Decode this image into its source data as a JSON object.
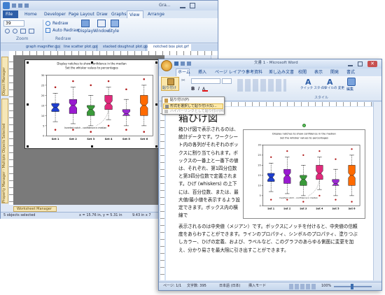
{
  "app": {
    "title": "Gra...",
    "tabs": [
      "File",
      "Home",
      "Developer",
      "Page Layout",
      "Draw",
      "Graphs",
      "View",
      "Arrange"
    ],
    "active_tab": "View",
    "zoom_value": "39",
    "redraw_label": "Redraw",
    "auto_redraw_label": "Auto Redraw",
    "window_label": "Window",
    "display_label": "Display",
    "style_label": "Style",
    "group_zoom": "Zoom",
    "group_redraw": "Redraw",
    "doc_tabs": [
      "graph magnifier.gpj",
      "line scatter plot.gpj",
      "stacked doughnut plot.gpj",
      "notched box plot.grf"
    ],
    "side_panels": [
      "Object Manager",
      "Property Manager - Multiple Objects Selected"
    ],
    "worksheet_manager": "Worksheet Manager",
    "status_left": "5 objects selected",
    "status_coords": "x = 15.76 in, y = 5.31 in",
    "status_size": "9.43 in x 7"
  },
  "word": {
    "title": "文書 1 - Microsoft Word",
    "tabs": [
      "ホーム",
      "挿入",
      "ページ レイアウト",
      "参考資料",
      "差し込み文書",
      "校閲",
      "表示",
      "開発",
      "書式"
    ],
    "active_tab": "ホーム",
    "paste_label": "貼り付け",
    "menu_items": [
      "貼り付け(P)",
      "形式を選択して貼り付け(S)...",
      "ハイパーリンクとして貼り付け(H)"
    ],
    "quick_style": "クイック スタイル",
    "style_change": "スタイルの 変更",
    "edit_label": "編集",
    "style_group": "スタイル",
    "heading": "箱ひげ図",
    "body_narrow": "箱ひげ図で表示されるのは、統計データです。ワークシート内の各列がそれぞれのボックスに割り当てられます。ボックスの一番上と一番下の値は、それぞれ、第1四分位数と第3四分位数で定義されます。ひげ (whiskers) の上下には、百分位数、または、最大値/最小値を表示するよう設定できます。ボックス内の横線で",
    "body_wide": "表示されるのは中央値（メジアン）です。ボックスにノッチを付けると、中央値の信頼度をあらわすことができます。ラインのプロパティ、シンボルのプロパティ、塗りつぶしカラー、ひげの定義、および、ラベルなど、このグラフのあらゆる側面に変更を加え、分かり易さを最大限に引き出すことができます。",
    "status_page": "ページ: 1/1",
    "status_words": "文字数: 395",
    "status_lang": "日本語 (日本)",
    "status_mode": "挿入モード",
    "zoom_pct": "100%"
  },
  "chart_data": {
    "type": "box",
    "title": "Display notches to show confidence in the median",
    "subtitle": "Set the whisker values to percentages",
    "categories": [
      "Set 1",
      "Set 2",
      "Set 3",
      "Set 4",
      "Set 5",
      "Set 6"
    ],
    "annotation": "Inverted notch - confidence in median",
    "ylim": [
      0,
      30
    ],
    "yticks": [
      0,
      5,
      10,
      15,
      20,
      25,
      30
    ],
    "colors": [
      "#1f3fd0",
      "#9a1ad0",
      "#3a9a3a",
      "#e02a7c",
      "#9a2ad0",
      "#ff6a00"
    ],
    "boxes": [
      {
        "q1": 12,
        "median": 14,
        "q3": 16,
        "lo": 7,
        "hi": 21,
        "outliers": [
          24,
          3
        ]
      },
      {
        "q1": 11,
        "median": 15,
        "q3": 18,
        "lo": 6,
        "hi": 24,
        "outliers": [
          27,
          3
        ]
      },
      {
        "q1": 10,
        "median": 13,
        "q3": 15,
        "lo": 5,
        "hi": 20,
        "outliers": [
          25,
          2
        ]
      },
      {
        "q1": 13,
        "median": 16,
        "q3": 20,
        "lo": 8,
        "hi": 24,
        "outliers": [
          27,
          5
        ]
      },
      {
        "q1": 10,
        "median": 11,
        "q3": 13,
        "lo": 5,
        "hi": 18,
        "outliers": [
          23,
          3
        ]
      },
      {
        "q1": 10,
        "median": 15,
        "q3": 20,
        "lo": 5,
        "hi": 25,
        "outliers": [
          28,
          2
        ]
      }
    ]
  }
}
